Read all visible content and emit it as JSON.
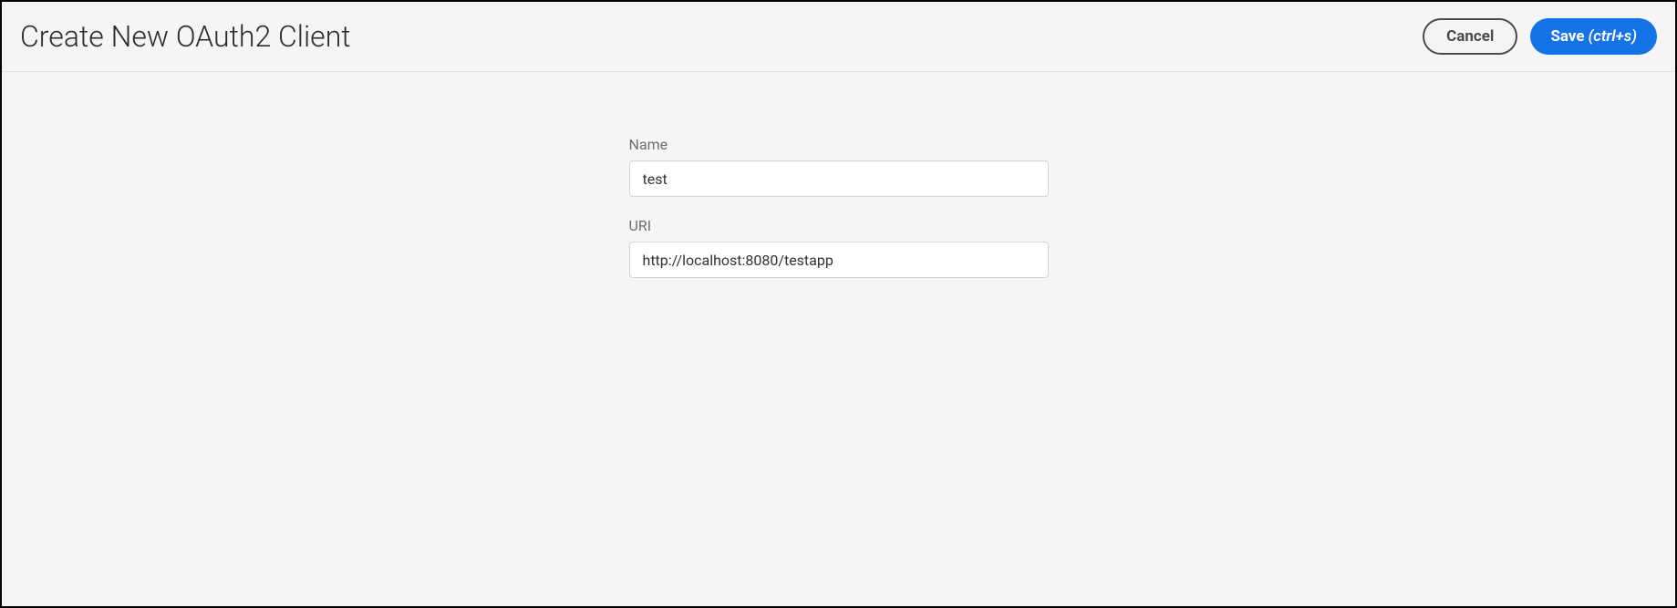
{
  "header": {
    "title": "Create New OAuth2 Client",
    "cancel_label": "Cancel",
    "save_label": "Save",
    "save_shortcut": "(ctrl+s)"
  },
  "form": {
    "name": {
      "label": "Name",
      "value": "test"
    },
    "uri": {
      "label": "URI",
      "value": "http://localhost:8080/testapp"
    }
  }
}
